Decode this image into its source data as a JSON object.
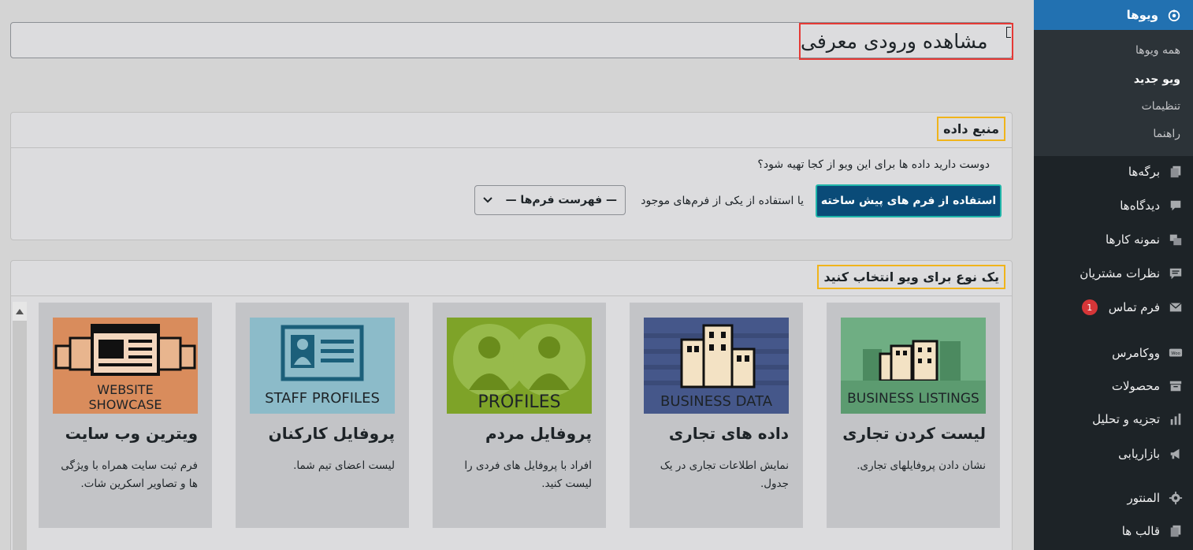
{
  "sidebar": {
    "active": {
      "label": "ویوها",
      "icon": "toolset-icon"
    },
    "submenu": [
      {
        "label": "همه ویوها",
        "current": false
      },
      {
        "label": "ویو جدید",
        "current": true
      },
      {
        "label": "تنظیمات",
        "current": false
      },
      {
        "label": "راهنما",
        "current": false
      }
    ],
    "items": [
      {
        "label": "برگه‌ها",
        "icon": "pages-icon"
      },
      {
        "label": "دیدگاه‌ها",
        "icon": "comments-icon"
      },
      {
        "label": "نمونه کارها",
        "icon": "portfolio-icon"
      },
      {
        "label": "نظرات مشتریان",
        "icon": "testimonials-icon"
      },
      {
        "label": "فرم تماس",
        "icon": "mail-icon",
        "badge": "1"
      },
      {
        "label": "ووکامرس",
        "icon": "woocommerce-icon"
      },
      {
        "label": "محصولات",
        "icon": "archive-icon"
      },
      {
        "label": "تجزیه و تحلیل",
        "icon": "chart-icon"
      },
      {
        "label": "بازاریابی",
        "icon": "megaphone-icon"
      },
      {
        "label": "المنتور",
        "icon": "gear-icon"
      },
      {
        "label": "قالب ها",
        "icon": "templates-icon"
      }
    ]
  },
  "main": {
    "title_value": "مشاهده ورودی معرفی",
    "data_source": {
      "heading": "منبع داده",
      "question": "دوست دارید داده ها برای این ویو از کجا تهیه شود؟",
      "prebuilt_button": "استفاده از فرم های پیش ساخته",
      "or_text": "یا استفاده از یکی از فرم‌های موجود",
      "select_value": "— فهرست فرم‌ها —"
    },
    "view_type": {
      "heading": "یک نوع برای ویو انتخاب کنید",
      "cards": [
        {
          "title": "لیست کردن تجاری",
          "desc": "نشان دادن پروفایلهای تجاری.",
          "thumb_label": "BUSINESS LISTINGS",
          "thumb_color": "#6fae83"
        },
        {
          "title": "داده های تجاری",
          "desc": "نمایش اطلاعات تجاری در یک جدول.",
          "thumb_label": "BUSINESS DATA",
          "thumb_color": "#45578a"
        },
        {
          "title": "پروفایل مردم",
          "desc": "افراد با پروفایل های فردی را لیست کنید.",
          "thumb_label": "PROFILES",
          "thumb_color": "#7ea328"
        },
        {
          "title": "پروفایل کارکنان",
          "desc": "لیست اعضای تیم شما.",
          "thumb_label": "STAFF PROFILES",
          "thumb_color": "#8cbbc9"
        },
        {
          "title": "ویترین وب سایت",
          "desc": "فرم ثبت سایت همراه با ویژگی ها و تصاویر اسکرین شات.",
          "thumb_label_1": "WEBSITE",
          "thumb_label_2": "SHOWCASE",
          "thumb_color": "#d98c5c"
        }
      ]
    }
  }
}
